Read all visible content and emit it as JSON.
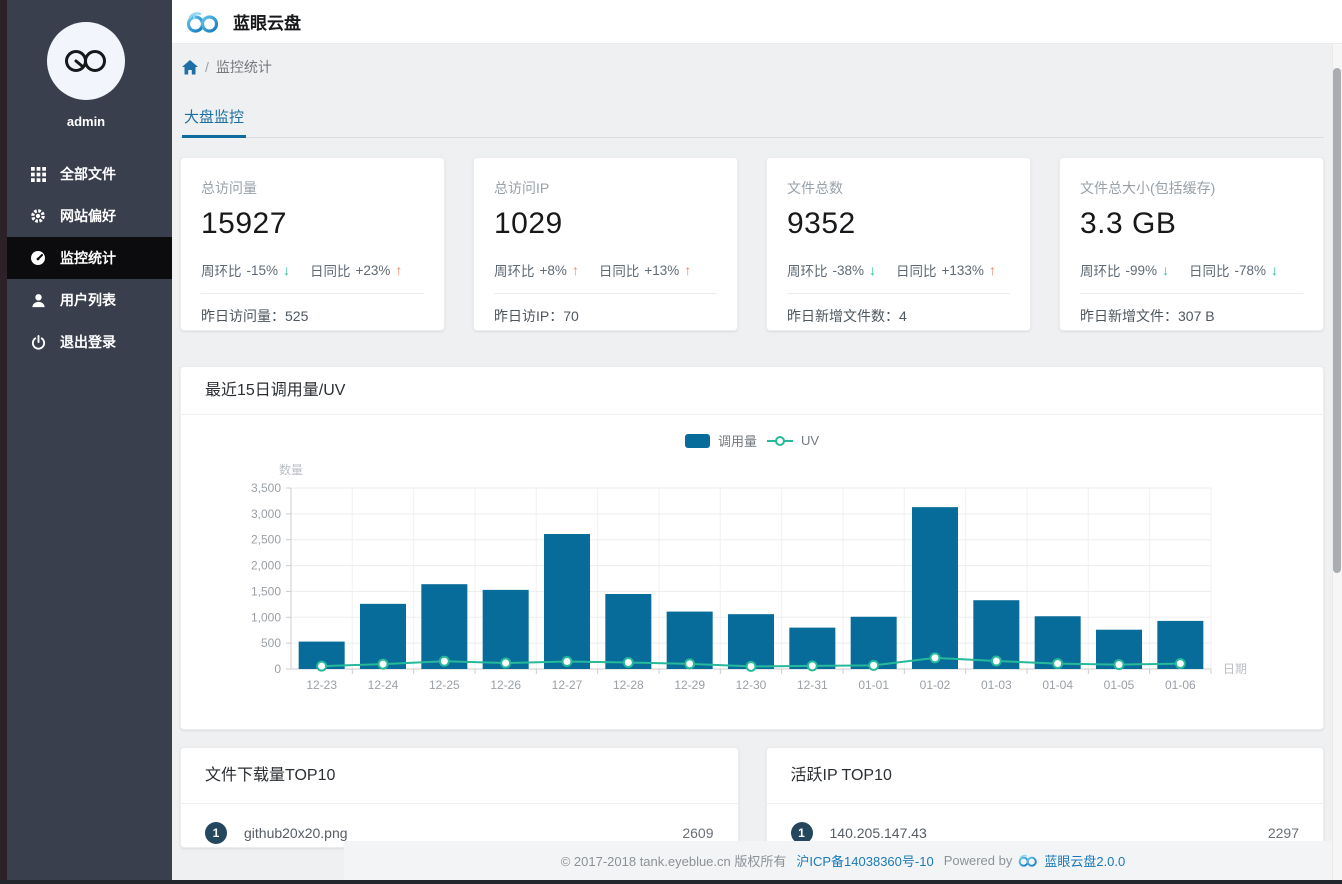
{
  "header": {
    "title": "蓝眼云盘"
  },
  "sidebar": {
    "username": "admin",
    "items": [
      {
        "label": "全部文件",
        "icon": "grid-icon",
        "active": false
      },
      {
        "label": "网站偏好",
        "icon": "gear-icon",
        "active": false
      },
      {
        "label": "监控统计",
        "icon": "gauge-icon",
        "active": true
      },
      {
        "label": "用户列表",
        "icon": "user-icon",
        "active": false
      },
      {
        "label": "退出登录",
        "icon": "power-icon",
        "active": false
      }
    ]
  },
  "breadcrumb": {
    "separator": "/",
    "current": "监控统计"
  },
  "tabs": {
    "items": [
      {
        "label": "大盘监控",
        "active": true
      }
    ]
  },
  "stats": [
    {
      "title": "总访问量",
      "value": "15927",
      "week": {
        "label": "周环比",
        "delta": "-15%",
        "direction": "down"
      },
      "day": {
        "label": "日同比",
        "delta": "+23%",
        "direction": "up"
      },
      "yesterday": {
        "label": "昨日访问量：",
        "value": "525"
      }
    },
    {
      "title": "总访问IP",
      "value": "1029",
      "week": {
        "label": "周环比",
        "delta": "+8%",
        "direction": "up"
      },
      "day": {
        "label": "日同比",
        "delta": "+13%",
        "direction": "up"
      },
      "yesterday": {
        "label": "昨日访IP：",
        "value": "70"
      }
    },
    {
      "title": "文件总数",
      "value": "9352",
      "week": {
        "label": "周环比",
        "delta": "-38%",
        "direction": "down"
      },
      "day": {
        "label": "日同比",
        "delta": "+133%",
        "direction": "up"
      },
      "yesterday": {
        "label": "昨日新增文件数：",
        "value": "4"
      }
    },
    {
      "title": "文件总大小(包括缓存)",
      "value": "3.3 GB",
      "week": {
        "label": "周环比",
        "delta": "-99%",
        "direction": "down"
      },
      "day": {
        "label": "日同比",
        "delta": "-78%",
        "direction": "down"
      },
      "yesterday": {
        "label": "昨日新增文件：",
        "value": "307 B"
      }
    }
  ],
  "chart_card": {
    "title": "最近15日调用量/UV"
  },
  "chart_data": {
    "type": "bar",
    "title": "最近15日调用量/UV",
    "categories": [
      "12-23",
      "12-24",
      "12-25",
      "12-26",
      "12-27",
      "12-28",
      "12-29",
      "12-30",
      "12-31",
      "01-01",
      "01-02",
      "01-03",
      "01-04",
      "01-05",
      "01-06"
    ],
    "series": [
      {
        "name": "调用量",
        "type": "bar",
        "color": "#076c99",
        "values": [
          530,
          1260,
          1640,
          1530,
          2610,
          1450,
          1110,
          1060,
          800,
          1010,
          3130,
          1330,
          1020,
          760,
          930
        ]
      },
      {
        "name": "UV",
        "type": "line",
        "color": "#26b99a",
        "values": [
          55,
          95,
          150,
          115,
          145,
          125,
          100,
          50,
          60,
          70,
          215,
          155,
          105,
          85,
          105
        ]
      }
    ],
    "xlabel": "日期",
    "ylabel": "数量",
    "ylim": [
      0,
      3500
    ],
    "ytick_step": 500,
    "grid": true,
    "legend_position": "top-center"
  },
  "top_lists": [
    {
      "title": "文件下载量TOP10",
      "items": [
        {
          "rank": "1",
          "name": "github20x20.png",
          "value": "2609"
        }
      ]
    },
    {
      "title": "活跃IP TOP10",
      "items": [
        {
          "rank": "1",
          "name": "140.205.147.43",
          "value": "2297"
        }
      ]
    }
  ],
  "footer": {
    "copyright": "© 2017-2018 tank.eyeblue.cn 版权所有",
    "icp_link": "沪ICP备14038360号-10",
    "powered_by": "Powered by",
    "product_link": "蓝眼云盘2.0.0"
  },
  "colors": {
    "bar_blue": "#076c99",
    "line_teal": "#26b99a",
    "up_orange": "#f0835e",
    "down_green": "#2abf9e",
    "accent_blue": "#1d6fa5",
    "sidebar_bg": "#3a3f4e",
    "sidebar_active_bg": "#0c0c0f",
    "badge_navy": "#25475e"
  }
}
